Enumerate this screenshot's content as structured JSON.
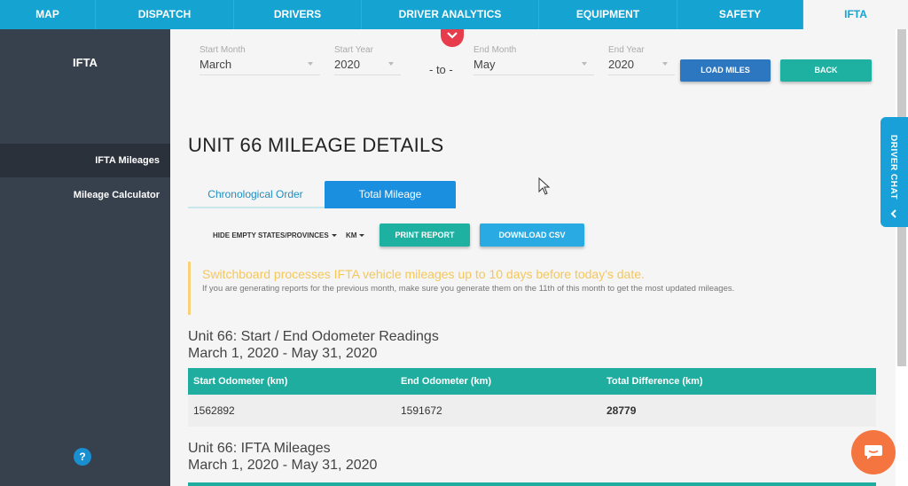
{
  "nav": {
    "tabs": [
      {
        "label": "MAP"
      },
      {
        "label": "DISPATCH"
      },
      {
        "label": "DRIVERS"
      },
      {
        "label": "DRIVER ANALYTICS"
      },
      {
        "label": "EQUIPMENT"
      },
      {
        "label": "SAFETY"
      },
      {
        "label": "IFTA"
      }
    ],
    "active": "IFTA"
  },
  "sidebar": {
    "title": "IFTA",
    "items": [
      {
        "label": "IFTA Mileages"
      },
      {
        "label": "Mileage Calculator"
      }
    ],
    "help_label": "?"
  },
  "filters": {
    "start_month": {
      "label": "Start Month",
      "value": "March"
    },
    "start_year": {
      "label": "Start Year",
      "value": "2020"
    },
    "to_text": "- to -",
    "end_month": {
      "label": "End Month",
      "value": "May"
    },
    "end_year": {
      "label": "End Year",
      "value": "2020"
    },
    "load_button": "LOAD MILES",
    "back_button": "BACK"
  },
  "page": {
    "title": "UNIT 66 MILEAGE DETAILS",
    "tabs": [
      {
        "label": "Chronological Order"
      },
      {
        "label": "Total Mileage"
      }
    ]
  },
  "toolbar": {
    "hide_empty": "HIDE EMPTY STATES/PROVINCES",
    "unit": "KM",
    "print_button": "PRINT REPORT",
    "download_button": "DOWNLOAD CSV"
  },
  "notice": {
    "heading": "Switchboard processes IFTA vehicle mileages up to 10 days before today's date.",
    "text": "If you are generating reports for the previous month, make sure you generate them on the 11th of this month to get the most updated mileages."
  },
  "odometer": {
    "title": "Unit 66: Start / End Odometer Readings",
    "date_range": "March 1, 2020 - May 31, 2020",
    "columns": [
      "Start Odometer (km)",
      "End Odometer (km)",
      "Total Difference (km)"
    ],
    "rows": [
      [
        "1562892",
        "1591672",
        "28779"
      ]
    ]
  },
  "mileages": {
    "title": "Unit 66: IFTA Mileages",
    "date_range": "March 1, 2020 - May 31, 2020"
  },
  "driver_chat": {
    "label": "DRIVER CHAT"
  },
  "colors": {
    "nav": "#15a3d2",
    "sidebar": "#37404d",
    "teal": "#1fada0",
    "blue_button": "#2d77c1",
    "chat": "#f47540",
    "notice": "#f5c75a"
  }
}
